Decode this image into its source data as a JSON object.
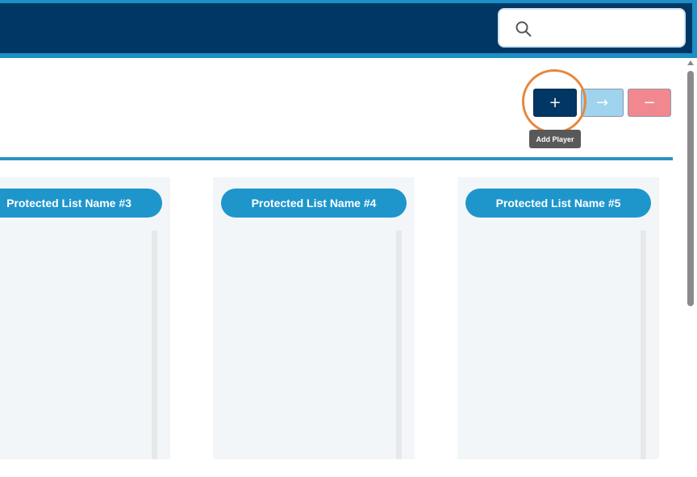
{
  "search": {
    "placeholder": "",
    "value": ""
  },
  "toolbar": {
    "add_label": "+",
    "move_label": "→",
    "remove_label": "−",
    "tooltip": "Add Player"
  },
  "lists": [
    {
      "name": "Protected List Name #3"
    },
    {
      "name": "Protected List Name #4"
    },
    {
      "name": "Protected List Name #5"
    }
  ],
  "colors": {
    "navy": "#003764",
    "accent_blue": "#1e96cc",
    "move_button": "#9fd3ee",
    "remove_button": "#f2888f",
    "highlight": "#e8873a"
  },
  "icons": [
    "search-icon",
    "plus-icon",
    "arrow-right-icon",
    "minus-icon"
  ]
}
